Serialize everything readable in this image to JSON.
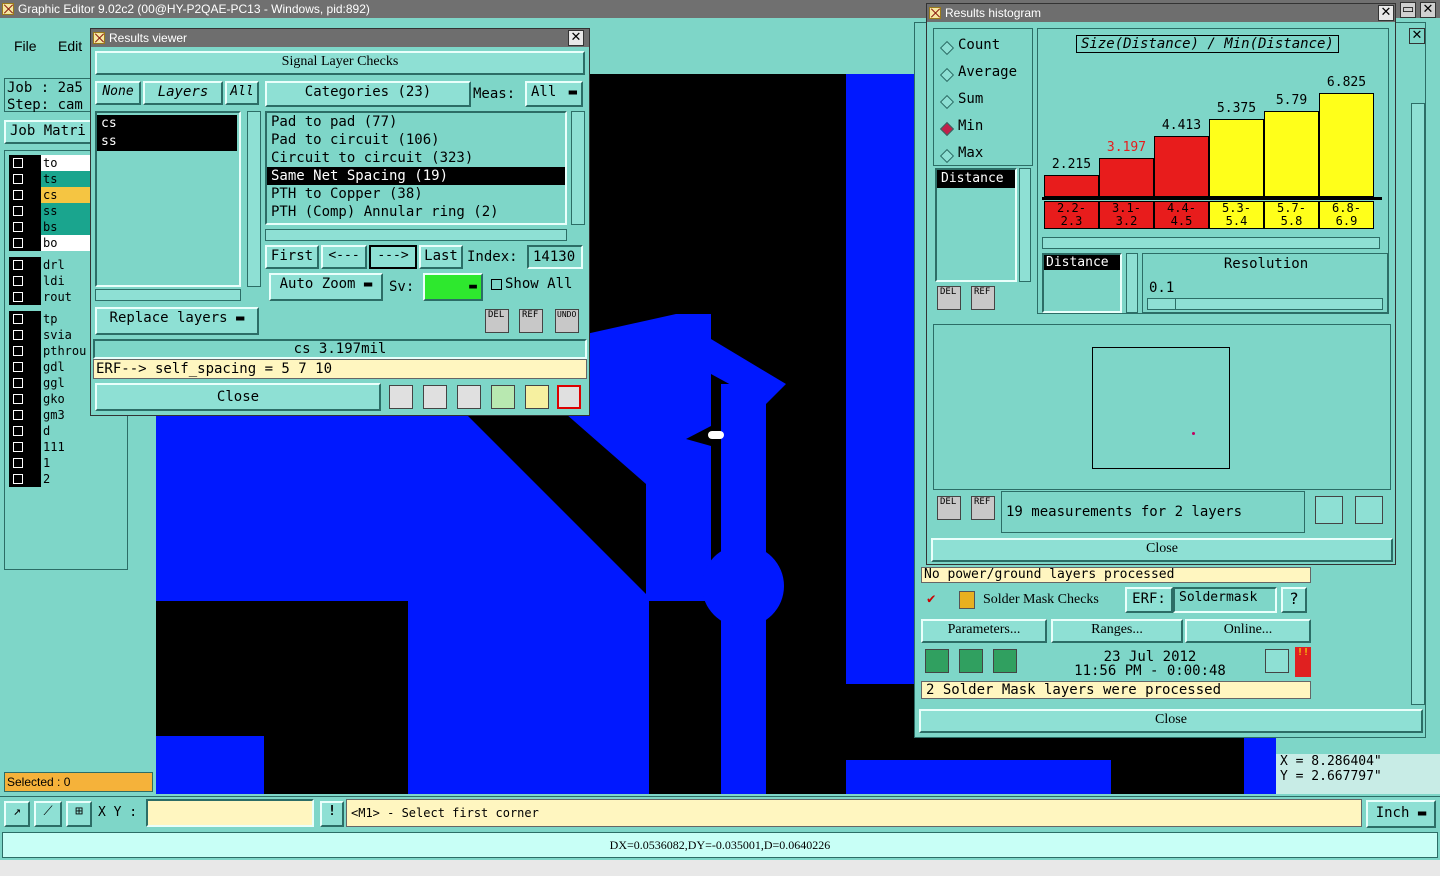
{
  "app": {
    "title": "Graphic Editor 9.02c2 (00@HY-P2QAE-PC13 - Windows, pid:892)"
  },
  "menu": {
    "file": "File",
    "edit": "Edit"
  },
  "left": {
    "job": "Job : 2a5",
    "step": "Step: cam",
    "job_matrix": "Job Matri",
    "layers": [
      {
        "name": "to",
        "color": "#ffffff"
      },
      {
        "name": "ts",
        "color": "#1aa58e"
      },
      {
        "name": "cs",
        "color": "#f5c542"
      },
      {
        "name": "ss",
        "color": "#1aa58e"
      },
      {
        "name": "bs",
        "color": "#1aa58e"
      },
      {
        "name": "bo",
        "color": "#ffffff"
      },
      {
        "name": "drl",
        "color": "#7ed6c8"
      },
      {
        "name": "ldi",
        "color": "#7ed6c8"
      },
      {
        "name": "rout",
        "color": "#7ed6c8"
      },
      {
        "name": "tp",
        "color": "#7ed6c8"
      },
      {
        "name": "svia",
        "color": "#7ed6c8"
      },
      {
        "name": "pthrou",
        "color": "#7ed6c8"
      },
      {
        "name": "gdl",
        "color": "#7ed6c8"
      },
      {
        "name": "ggl",
        "color": "#7ed6c8"
      },
      {
        "name": "gko",
        "color": "#7ed6c8"
      },
      {
        "name": "gm3",
        "color": "#7ed6c8"
      },
      {
        "name": "d",
        "color": "#7ed6c8"
      },
      {
        "name": "111",
        "color": "#7ed6c8"
      },
      {
        "name": "1",
        "color": "#7ed6c8"
      },
      {
        "name": "2",
        "color": "#7ed6c8"
      }
    ],
    "selected": "Selected : 0"
  },
  "results_viewer": {
    "title": "Results viewer",
    "header": "Signal Layer Checks",
    "none": "None",
    "layers_btn": "Layers",
    "all_btn": "All",
    "layer_list": [
      "cs",
      "ss"
    ],
    "categories": "Categories (23)",
    "meas_label": "Meas:",
    "meas_value": "All",
    "category_items": [
      "Pad to pad (77)",
      "Pad to circuit (106)",
      "Circuit to circuit (323)",
      "Same Net Spacing (19)",
      "PTH to Copper (38)",
      "PTH (Comp) Annular ring (2)"
    ],
    "selected_category": 3,
    "first": "First",
    "prev": "<---",
    "next": "--->",
    "last": "Last",
    "index_label": "Index:",
    "index_value": "14130",
    "auto_zoom": "Auto Zoom",
    "sv_label": "Sv:",
    "show_all": "Show All",
    "replace_layers": "Replace layers",
    "status": "cs 3.197mil",
    "erf": "ERF--> self_spacing = 5 7 10",
    "close": "Close",
    "del": "DEL",
    "ref": "REF",
    "undo": "UNDO"
  },
  "histogram": {
    "title": "Results histogram",
    "modes": [
      "Count",
      "Average",
      "Sum",
      "Min",
      "Max"
    ],
    "selected_mode": "Min",
    "distance_list": "Distance",
    "chart_title": "Size(Distance) / Min(Distance)",
    "bars": [
      {
        "value": "2.215",
        "range": "2.2-\n2.3",
        "color": "#e81c1c"
      },
      {
        "value": "3.197",
        "range": "3.1-\n3.2",
        "color": "#e81c1c"
      },
      {
        "value": "4.413",
        "range": "4.4-\n4.5",
        "color": "#e81c1c"
      },
      {
        "value": "5.375",
        "range": "5.3-\n5.4",
        "color": "#ffff1a"
      },
      {
        "value": "5.79",
        "range": "5.7-\n5.8",
        "color": "#ffff1a"
      },
      {
        "value": "6.825",
        "range": "6.8-\n6.9",
        "color": "#ffff1a"
      }
    ],
    "distance_field": "Distance",
    "resolution_label": "Resolution",
    "resolution_value": "0.1",
    "measurements": "19 measurements for 2 layers",
    "close": "Close",
    "del": "DEL",
    "ref": "REF"
  },
  "bg_panel": {
    "no_power": "No power/ground layers processed",
    "solder_mask": "Solder Mask Checks",
    "erf_label": "ERF:",
    "erf_value": "Soldermask",
    "help": "?",
    "parameters": "Parameters...",
    "ranges": "Ranges...",
    "online": "Online...",
    "date": "23 Jul 2012",
    "time": "11:56 PM - 0:00:48",
    "processed": "2 Solder Mask layers were processed",
    "close": "Close"
  },
  "coords": {
    "x": "X = 8.286404\"",
    "y": "Y = 2.667797\""
  },
  "bottom": {
    "xy_label": "X Y :",
    "xy_value": "",
    "hint": "<M1> - Select first corner",
    "units": "Inch",
    "measure": "DX=0.0536082,DY=-0.035001,D=0.0640226"
  }
}
